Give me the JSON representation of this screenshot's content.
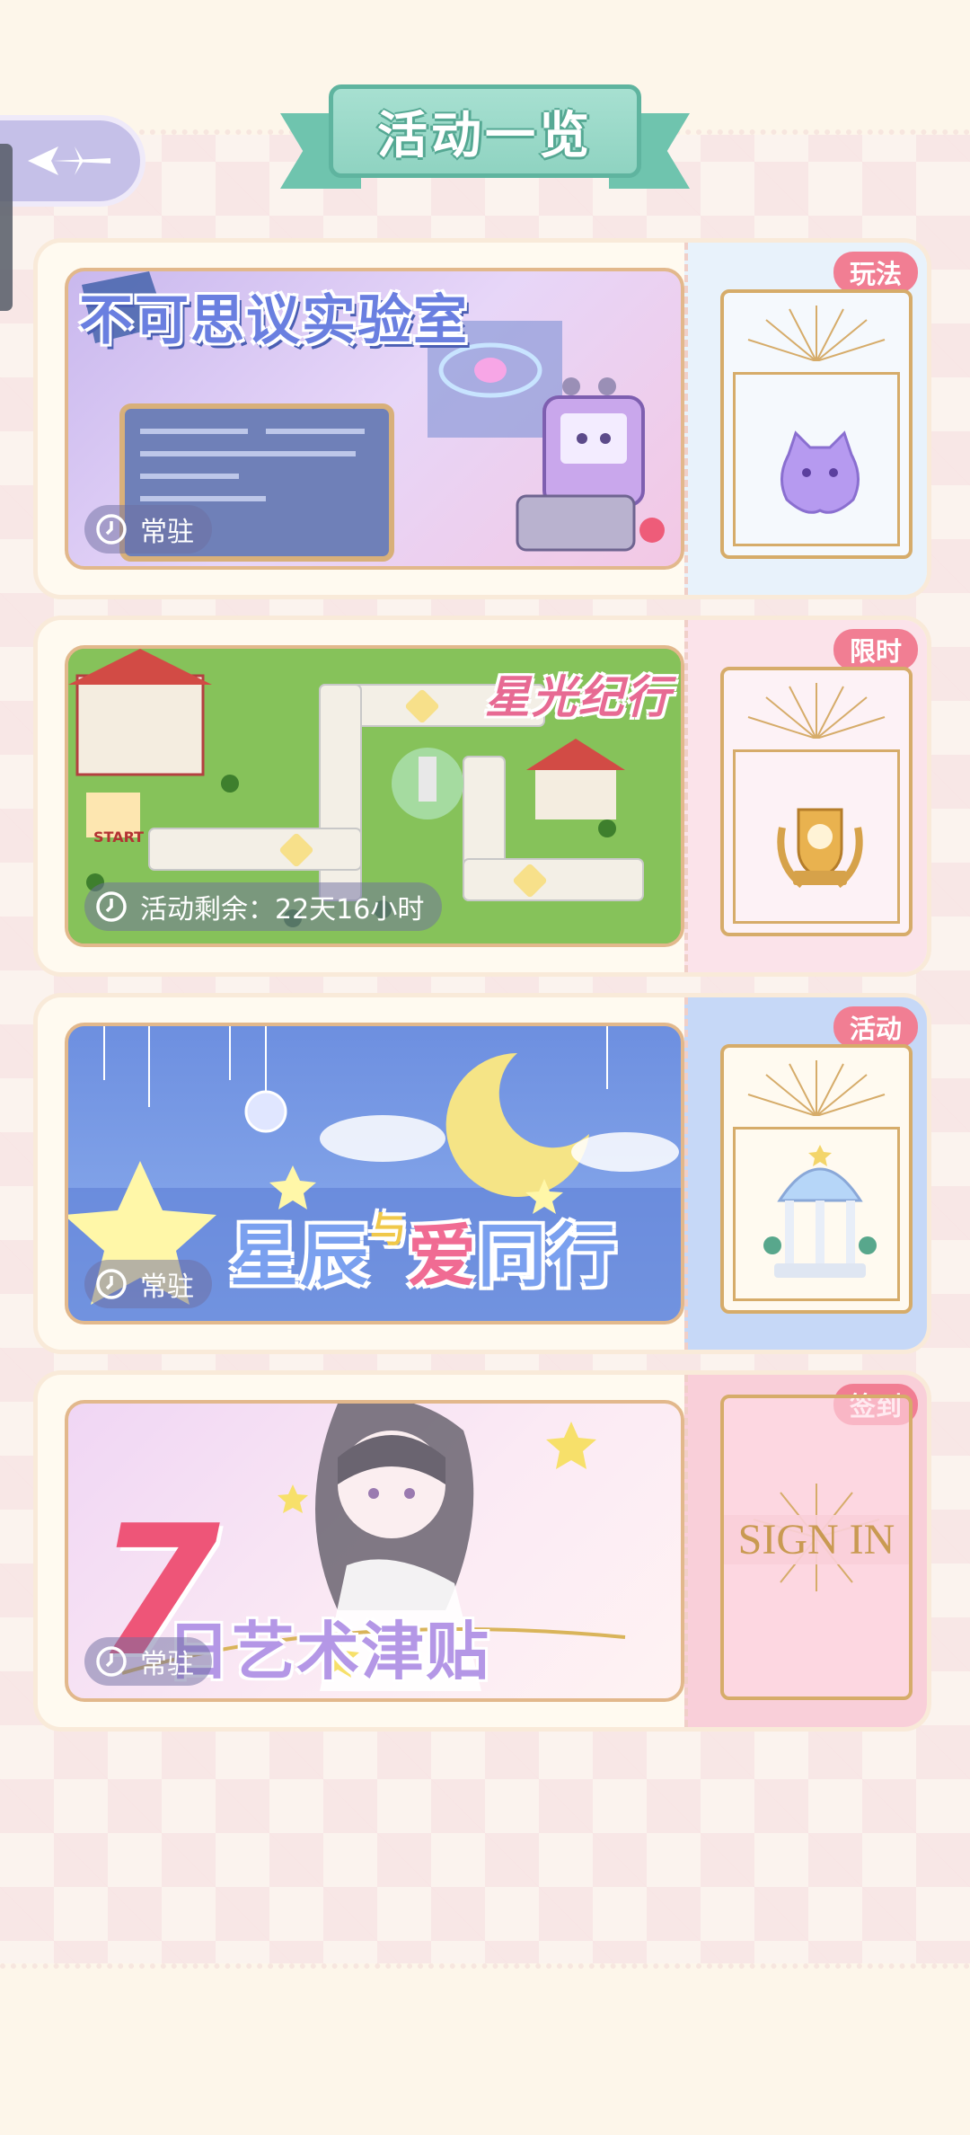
{
  "header": {
    "title": "活动一览"
  },
  "cards": [
    {
      "banner_title": "不可思议实验室",
      "status": "常驻",
      "tag": "玩法",
      "colors": {
        "bg_start": "#c9b8ee",
        "bg_end": "#f3c8e4",
        "stub": "#e8f2fb"
      }
    },
    {
      "banner_title": "星光纪行",
      "status": "活动剩余：22天16小时",
      "tag": "限时",
      "colors": {
        "bg_start": "#8fc65a",
        "bg_end": "#6fae45",
        "stub": "#fbe3ea"
      }
    },
    {
      "banner_title_1": "星辰",
      "banner_title_2": "与",
      "banner_title_3": "爱",
      "banner_title_4": "同行",
      "status": "常驻",
      "tag": "活动",
      "colors": {
        "bg_start": "#6d8fe0",
        "bg_end": "#9bb8f0",
        "stub": "#c6d8f7"
      }
    },
    {
      "banner_title_1": "7",
      "banner_title_2": "日艺术津贴",
      "status": "常驻",
      "tag": "签到",
      "stub_text": "SIGN IN",
      "colors": {
        "bg_start": "#f0d6f4",
        "bg_end": "#fff3f3",
        "stub": "#f9cfd9"
      }
    }
  ]
}
